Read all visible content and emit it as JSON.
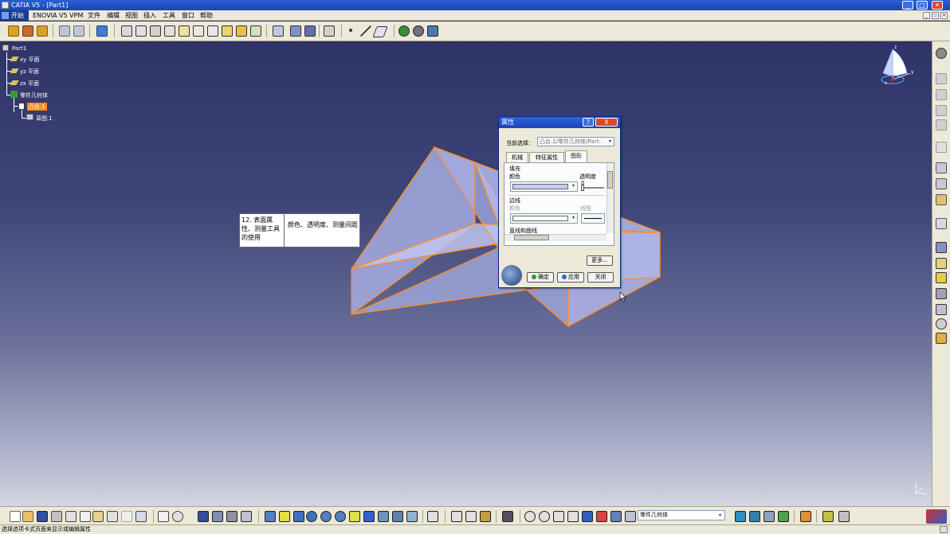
{
  "window": {
    "title": "CATIA V5 - [Part1]"
  },
  "menu": {
    "start": "开始",
    "items": [
      "ENOVIA V5 VPM",
      "文件",
      "编辑",
      "视图",
      "插入",
      "工具",
      "窗口",
      "帮助"
    ]
  },
  "tree": {
    "root": "Part1",
    "items": [
      "xy 平面",
      "yz 平面",
      "zx 平面",
      "零件几何体",
      "凸台.1",
      "草图.1"
    ]
  },
  "compass": {
    "x": "x",
    "y": "y",
    "z": "z"
  },
  "annotation": {
    "left": "12. 表面属性、测量工具的使用",
    "right": "颜色、透明度、测量间距"
  },
  "dialog": {
    "title": "属性",
    "help": "?",
    "close": "X",
    "current_selection_label": "当前选择：",
    "current_selection_value": "凸台.1/零件几何体/Part:",
    "tabs": [
      "机械",
      "特征属性",
      "图形"
    ],
    "fill_header": "填充",
    "color_label": "颜色",
    "transparency_label": "透明度",
    "transparency_value": "0",
    "edge_header": "边线",
    "edge_color_label": "颜色",
    "linetype_label": "线型",
    "lines_header": "直线和曲线",
    "more_button": "更多...",
    "ok_button": "确定",
    "apply_button": "应用",
    "close_button": "关闭",
    "fill_color": "#c8c8f0"
  },
  "bottom": {
    "body_combo": "零件几何体"
  },
  "status": {
    "text": "选择选项卡式页面来显示或编辑属性"
  },
  "colors": {
    "edge": "#ff8c1a",
    "face": "#aab0e6",
    "viewport_top": "#2f3468",
    "viewport_bottom": "#d4d6e2"
  }
}
